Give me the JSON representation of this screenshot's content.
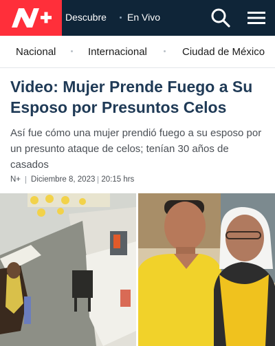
{
  "brand": {
    "logo_text": "N+",
    "color": "#ff2f3a",
    "bar_color": "#0f2538"
  },
  "topnav": {
    "items": [
      "Descubre",
      "En Vivo"
    ],
    "icons": [
      "search-icon",
      "menu-icon"
    ]
  },
  "sections": [
    "Nacional",
    "Internacional",
    "Ciudad de México"
  ],
  "article": {
    "headline": "Video: Mujer Prende Fuego a Su Esposo por Presuntos Celos",
    "summary": "Así fue cómo una mujer prendió fuego a su esposo por un presunto ataque de celos; tenían 30 años de casados",
    "byline": {
      "source": "N+",
      "date": "Diciembre 8, 2023",
      "time": "20:15 hrs"
    }
  }
}
